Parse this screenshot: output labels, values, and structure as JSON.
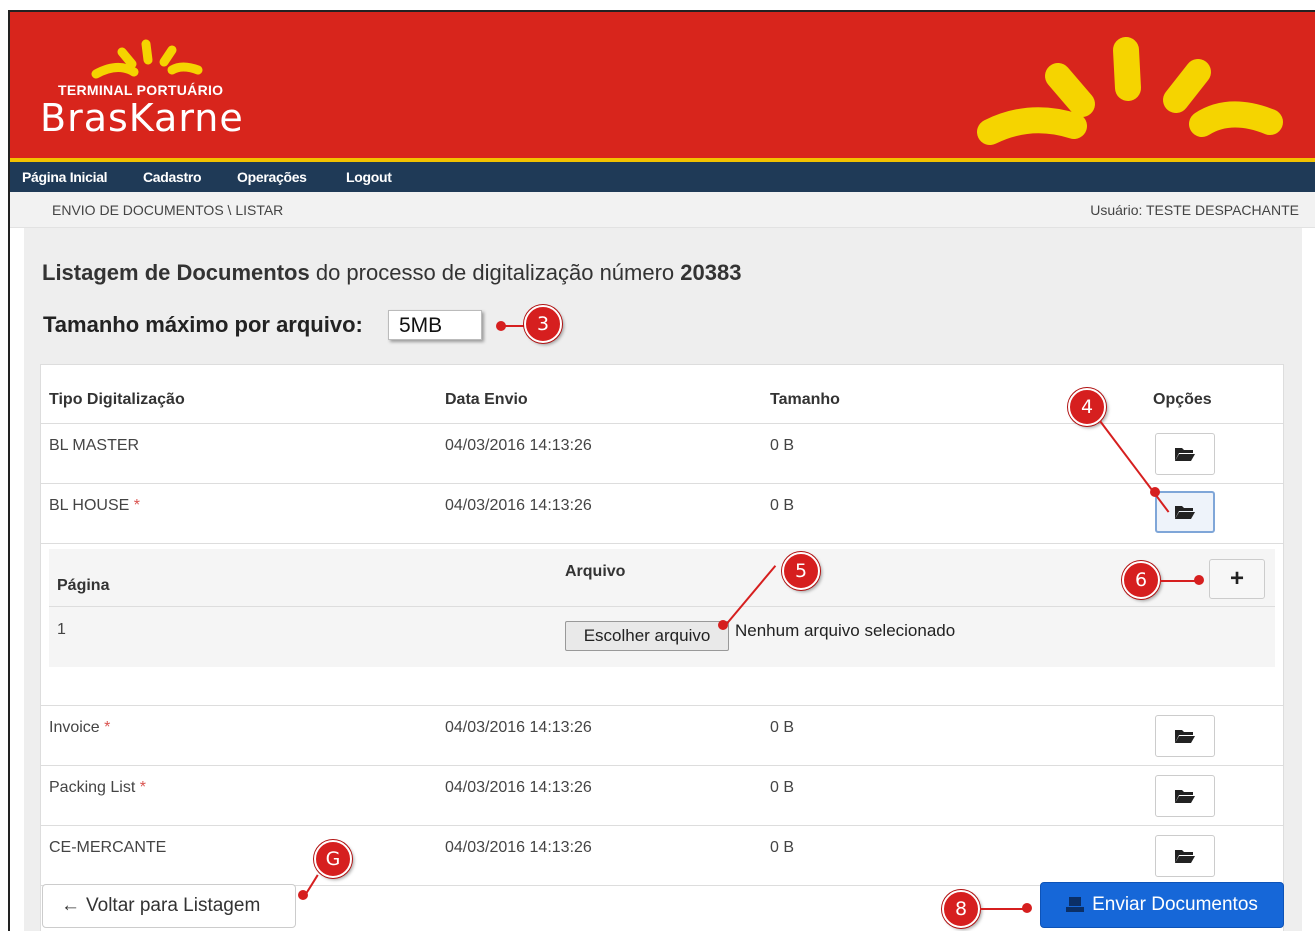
{
  "header": {
    "logo_sub": "TERMINAL PORTUÁRIO",
    "logo_main": "BrasKarne",
    "brand_color": "#d8251c",
    "accent_color": "#f2c200"
  },
  "nav": {
    "items": [
      "Página Inicial",
      "Cadastro",
      "Operações",
      "Logout"
    ]
  },
  "breadcrumb": "ENVIO DE DOCUMENTOS \\ LISTAR",
  "user_info": "Usuário: TESTE DESPACHANTE",
  "page": {
    "title_bold": "Listagem de Documentos",
    "title_text": " do processo de digitalização número ",
    "process_number": "20383",
    "max_size_label": "Tamanho máximo por arquivo:",
    "max_size_value": "5MB"
  },
  "table": {
    "headers": [
      "Tipo Digitalização",
      "Data Envio",
      "Tamanho",
      "Opções"
    ],
    "rows": [
      {
        "tipo": "BL MASTER",
        "required": "",
        "data": "04/03/2016 14:13:26",
        "tamanho": "0 B"
      },
      {
        "tipo": "BL HOUSE",
        "required": "*",
        "data": "04/03/2016 14:13:26",
        "tamanho": "0 B"
      },
      {
        "tipo": "Invoice",
        "required": "*",
        "data": "04/03/2016 14:13:26",
        "tamanho": "0 B"
      },
      {
        "tipo": "Packing List",
        "required": "*",
        "data": "04/03/2016 14:13:26",
        "tamanho": "0 B"
      },
      {
        "tipo": "CE-MERCANTE",
        "required": "",
        "data": "04/03/2016 14:13:26",
        "tamanho": "0 B"
      }
    ],
    "option_icon": "folder-open-icon"
  },
  "subtable": {
    "headers": [
      "Página",
      "Arquivo"
    ],
    "page_number": "1",
    "file_button": "Escolher arquivo",
    "file_status": "Nenhum arquivo selecionado",
    "add_icon": "+"
  },
  "buttons": {
    "back_label": "Voltar para Listagem",
    "back_icon": "←",
    "send_label": "Enviar Documentos",
    "send_color": "#1667d8"
  },
  "callouts": [
    "3",
    "4",
    "5",
    "6",
    "G",
    "8"
  ]
}
